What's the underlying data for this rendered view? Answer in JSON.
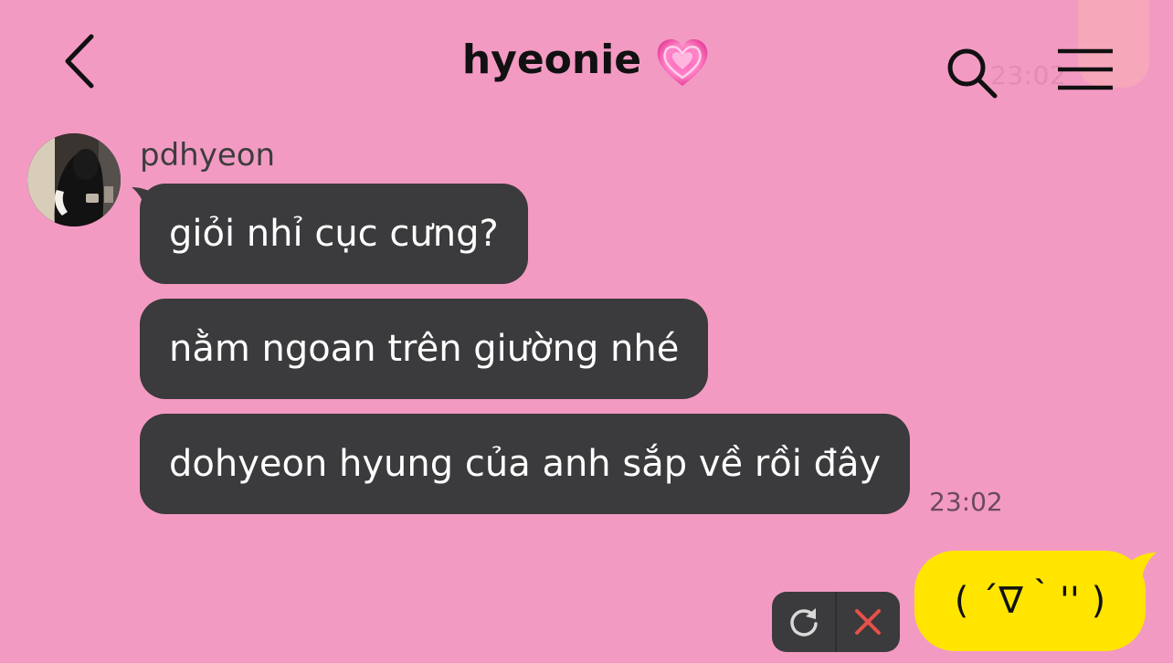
{
  "header": {
    "title": "hyeonie",
    "title_emoji": "heart-icon",
    "back_icon": "chevron-left-icon",
    "search_icon": "search-icon",
    "menu_icon": "menu-icon"
  },
  "background_overlay": {
    "ghost_timestamp": "23:02"
  },
  "chat": {
    "incoming": {
      "sender_name": "pdhyeon",
      "avatar": "avatar",
      "messages": [
        {
          "text": "giỏi nhỉ cục cưng?"
        },
        {
          "text": "nằm ngoan trên giường nhé"
        },
        {
          "text": "dohyeon hyung của anh sắp về rồi đây"
        }
      ],
      "timestamp": "23:02"
    },
    "outgoing": {
      "text": "( ´∇｀'' )",
      "failed_actions": {
        "retry_icon": "refresh-icon",
        "delete_icon": "close-icon"
      }
    }
  },
  "colors": {
    "background": "#f39ac3",
    "incoming_bubble": "#3b3a3c",
    "outgoing_bubble": "#ffe500",
    "delete_accent": "#e8504a"
  }
}
